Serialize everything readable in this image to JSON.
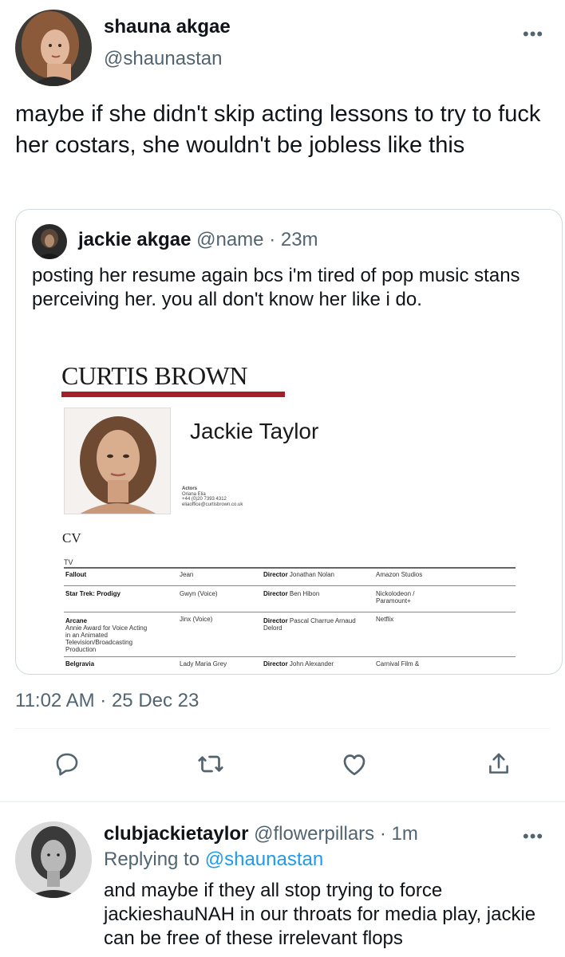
{
  "tweet": {
    "author_name": "shauna akgae",
    "author_handle": "@shaunastan",
    "text": "maybe if she didn't skip acting lessons to try to fuck her costars, she wouldn't be jobless like this",
    "timestamp": "11:02 AM · 25 Dec 23",
    "more_icon": "more-horizontal-icon"
  },
  "quote": {
    "author_name": "jackie akgae",
    "author_handle": "@name",
    "age": "· 23m",
    "text": "posting her resume again bcs i'm tired of pop music stans perceiving her. you all don't know her like i do.",
    "resume": {
      "agency": "CURTIS BROWN",
      "agency_color": "#a3202b",
      "actor_name": "Jackie Taylor",
      "contact_lines": [
        "Actors",
        "Oriana Elia",
        "+44 (0)20 7393 4312",
        "eliaoffice@curtisbrown.co.uk"
      ],
      "cv_label": "CV",
      "section": "TV",
      "rows": [
        {
          "title": "Fallout",
          "notes": [],
          "role": "Jean",
          "director_label": "Director",
          "director": "Jonathan Nolan",
          "company": "Amazon Studios"
        },
        {
          "title": "Star Trek: Prodigy",
          "notes": [],
          "role": "Gwyn (Voice)",
          "director_label": "Director",
          "director": "Ben Hibon",
          "company": "Nickolodeon / Paramount+"
        },
        {
          "title": "Arcane",
          "notes": [
            "Annie Award for Voice Acting",
            "in an Animated",
            "Television/Broadcasting",
            "Production"
          ],
          "role": "Jinx (Voice)",
          "director_label": "Director",
          "director": "Pascal Charrue Arnaud Delord",
          "company": "Netflix"
        },
        {
          "title": "Belgravia",
          "notes": [],
          "role": "Lady Maria Grey",
          "director_label": "Director",
          "director": "John Alexander",
          "company": "Carnival Film &"
        }
      ]
    }
  },
  "actions": [
    "reply-icon",
    "retweet-icon",
    "like-icon",
    "share-icon"
  ],
  "reply": {
    "author_name": "clubjackietaylor",
    "author_handle": "@flowerpillars",
    "age": "· 1m",
    "replying_prefix": "Replying to",
    "replying_handle": "@shaunastan",
    "text": "and maybe if they all stop trying to force jackieshauNAH in our throats for media play, jackie can be free of these irrelevant flops"
  },
  "colors": {
    "text_primary": "#0f1419",
    "text_secondary": "#536471",
    "link": "#1d9bf0",
    "border": "#cfd9de"
  }
}
